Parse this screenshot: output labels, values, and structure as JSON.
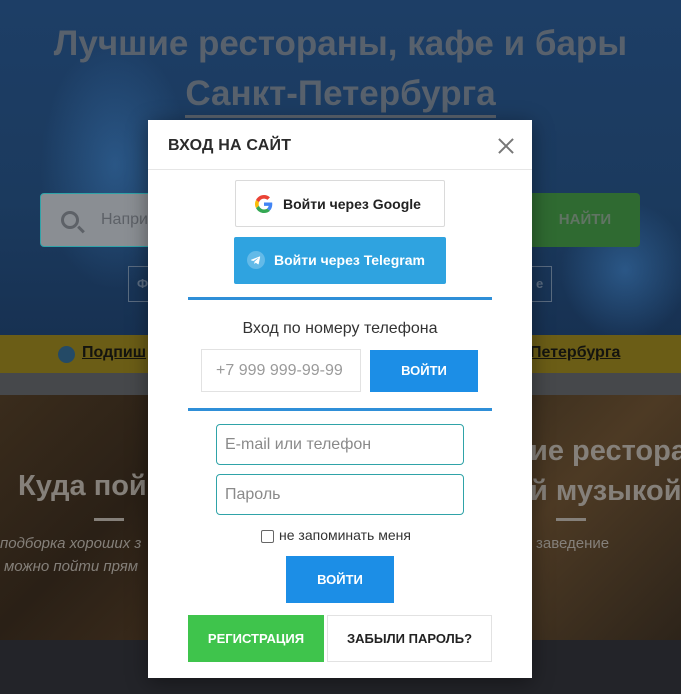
{
  "background": {
    "hero": {
      "title_line1": "Лучшие рестораны, кафе и бары",
      "title_line2": "Санкт-Петербурга",
      "search_placeholder": "Напри",
      "search_button": "НАЙТИ",
      "chip_left": "Ф",
      "chip_right": "е"
    },
    "strip": {
      "link_left": "Подпиш",
      "link_right": "Петербурга"
    },
    "cards": {
      "card1_title": "Куда пой",
      "card1_sub1": "подборка хороших з",
      "card1_sub2": "можно пойти прям",
      "card2_title1": "ие рестора",
      "card2_title2": "й музыкой",
      "card2_sub": "заведение"
    }
  },
  "modal": {
    "title": "ВХОД НА САЙТ",
    "close_icon": "close-icon",
    "google_label": "Войти через Google",
    "telegram_label": "Войти через Telegram",
    "phone_section_title": "Вход по номеру телефона",
    "phone_placeholder": "+7 999 999-99-99",
    "phone_button": "ВОЙТИ",
    "email_placeholder": "E-mail или телефон",
    "password_placeholder": "Пароль",
    "remember_label": "не запоминать меня",
    "login_button": "ВОЙТИ",
    "register_button": "РЕГИСТРАЦИЯ",
    "forgot_button": "ЗАБЫЛИ ПАРОЛЬ?"
  },
  "colors": {
    "accent_blue": "#1c8ee6",
    "telegram_blue": "#2fa3e0",
    "register_green": "#3fc44c",
    "input_border": "#2fa3a8"
  }
}
